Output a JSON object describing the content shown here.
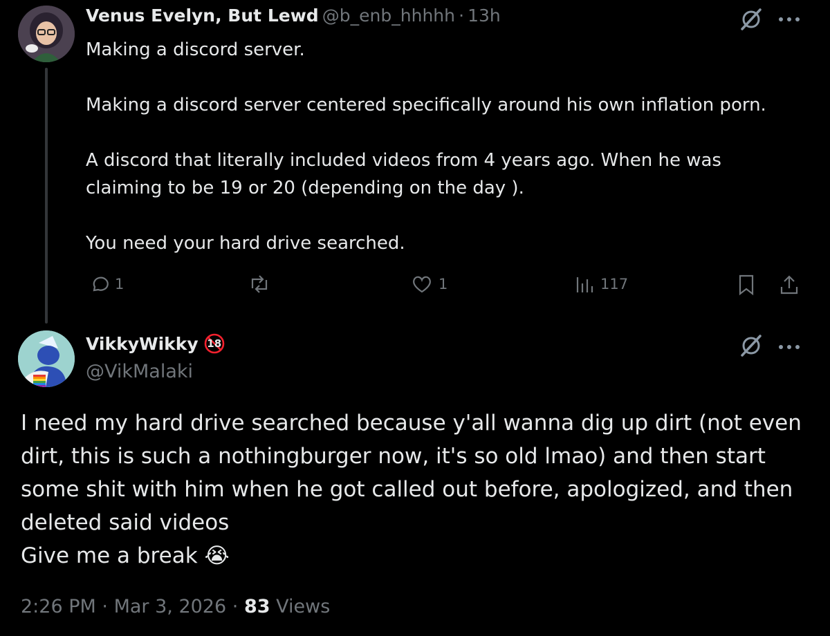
{
  "parent": {
    "name": "Venus Evelyn, But Lewd",
    "handle": "@b_enb_hhhhh",
    "separator": "·",
    "time": "13h",
    "lines": [
      "Making a discord server.",
      "",
      "Making a discord server centered specifically around his own inflation porn.",
      "",
      "A discord that literally included videos from 4 years ago. When he was",
      "claiming to be 19 or 20 (depending on the day ).",
      "",
      "You need your hard drive searched."
    ],
    "actions": {
      "replies": "1",
      "likes": "1",
      "views": "117"
    },
    "icons": [
      "grok-icon",
      "more-icon",
      "reply-icon",
      "retweet-icon",
      "like-icon",
      "views-icon",
      "bookmark-icon",
      "share-icon"
    ]
  },
  "reply": {
    "name": "VikkyWikky",
    "badge": "18",
    "handle": "@VikMalaki",
    "lines": [
      "I need my hard drive searched because y'all wanna dig up dirt (not even",
      "dirt, this is such a nothingburger now, it's so old lmao) and then start",
      "some shit with him when he got called out before, apologized, and then",
      "deleted said videos",
      "Give me a break"
    ],
    "emoji": "😭",
    "time": "2:26 PM",
    "date": "Mar 3, 2026",
    "views_count": "83",
    "views_label": "Views",
    "dot": "·"
  },
  "colors": {
    "background": "#000000",
    "text": "#e7e9ea",
    "muted": "#71767b",
    "badge": "#f4212e"
  }
}
